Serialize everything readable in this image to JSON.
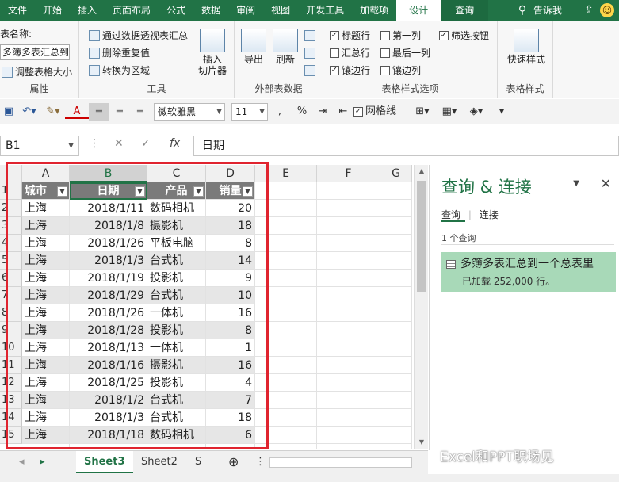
{
  "tabs": [
    "文件",
    "开始",
    "插入",
    "页面布局",
    "公式",
    "数据",
    "审阅",
    "视图",
    "开发工具",
    "加载项",
    "设计",
    "查询"
  ],
  "tell_me": "告诉我",
  "ribbon": {
    "props": {
      "table_name_label": "表名称:",
      "table_name_value": "多簿多表汇总到",
      "resize": "调整表格大小",
      "label": "属性"
    },
    "tools": {
      "pivot": "通过数据透视表汇总",
      "dedupe": "删除重复值",
      "convert": "转换为区域",
      "slicer": "插入\n切片器",
      "label": "工具"
    },
    "external": {
      "export": "导出",
      "refresh": "刷新",
      "label": "外部表数据"
    },
    "style_options": {
      "header_row": "标题行",
      "first_col": "第一列",
      "filter_btn": "筛选按钮",
      "total_row": "汇总行",
      "last_col": "最后一列",
      "banded_rows": "镶边行",
      "banded_cols": "镶边列",
      "label": "表格样式选项"
    },
    "styles": {
      "quick": "快速样式",
      "label": "表格样式"
    }
  },
  "format_bar": {
    "font": "微软雅黑",
    "size": "11",
    "gridlines": "网格线"
  },
  "formula_bar": {
    "name_box": "B1",
    "content": "日期"
  },
  "grid": {
    "columns": [
      "A",
      "B",
      "C",
      "D",
      "E",
      "F",
      "G"
    ],
    "row_numbers": [
      "1",
      "2",
      "3",
      "4",
      "5",
      "6",
      "7",
      "8",
      "9",
      "10",
      "11",
      "12",
      "13",
      "14",
      "15"
    ],
    "headers": [
      "城市",
      "日期",
      "产品",
      "销量"
    ],
    "rows": [
      [
        "上海",
        "2018/1/11",
        "数码相机",
        "20"
      ],
      [
        "上海",
        "2018/1/8",
        "摄影机",
        "18"
      ],
      [
        "上海",
        "2018/1/26",
        "平板电脑",
        "8"
      ],
      [
        "上海",
        "2018/1/3",
        "台式机",
        "14"
      ],
      [
        "上海",
        "2018/1/19",
        "投影机",
        "9"
      ],
      [
        "上海",
        "2018/1/29",
        "台式机",
        "10"
      ],
      [
        "上海",
        "2018/1/26",
        "一体机",
        "16"
      ],
      [
        "上海",
        "2018/1/28",
        "投影机",
        "8"
      ],
      [
        "上海",
        "2018/1/13",
        "一体机",
        "1"
      ],
      [
        "上海",
        "2018/1/16",
        "摄影机",
        "16"
      ],
      [
        "上海",
        "2018/1/25",
        "投影机",
        "4"
      ],
      [
        "上海",
        "2018/1/2",
        "台式机",
        "7"
      ],
      [
        "上海",
        "2018/1/3",
        "台式机",
        "18"
      ],
      [
        "上海",
        "2018/1/18",
        "数码相机",
        "6"
      ]
    ]
  },
  "sheets": [
    "Sheet3",
    "Sheet2",
    "S"
  ],
  "query_pane": {
    "title": "查询 & 连接",
    "tab_queries": "查询",
    "tab_connections": "连接",
    "count": "1 个查询",
    "item_name": "多簿多表汇总到一个总表里",
    "item_status": "已加载 252,000 行。"
  },
  "watermark": "Excel和PPT职场见"
}
